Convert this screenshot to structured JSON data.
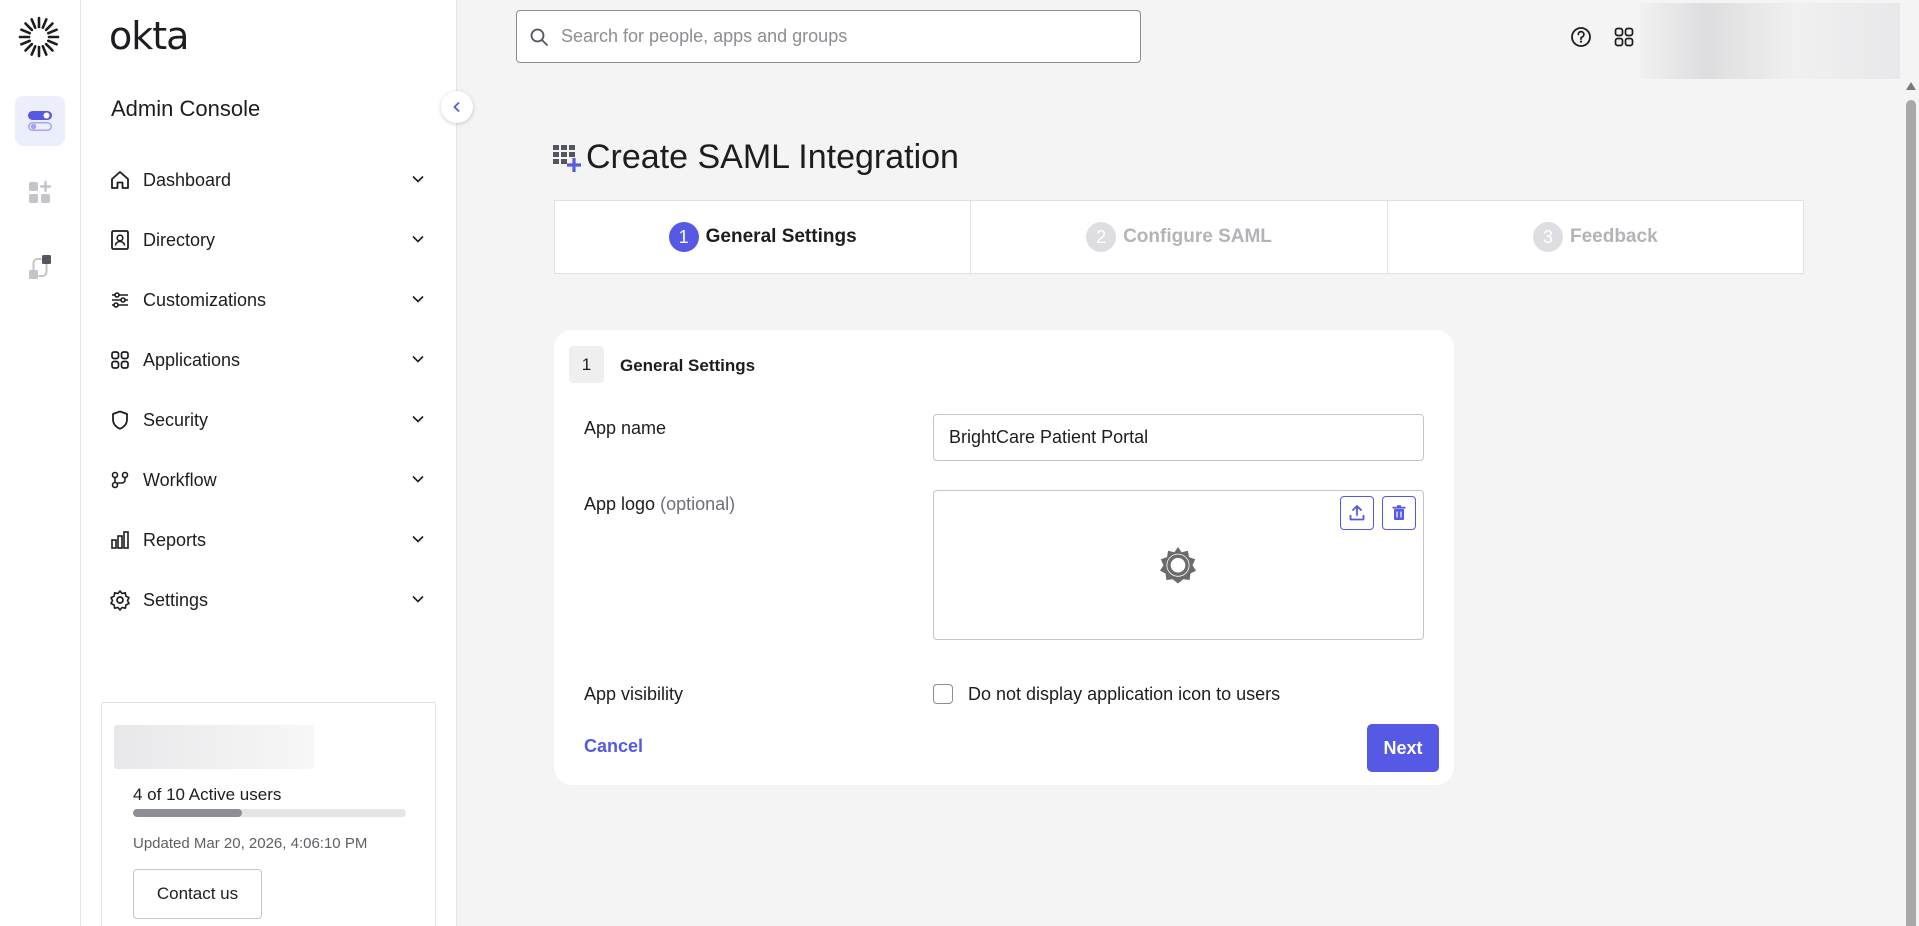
{
  "brand": {
    "wordmark": "okta",
    "accent": "#5559e3"
  },
  "rail": {
    "items": [
      "toggle-icon",
      "add-apps-icon",
      "integrations-icon"
    ]
  },
  "sidebar": {
    "console_title": "Admin Console",
    "items": [
      {
        "label": "Dashboard",
        "icon": "home-icon"
      },
      {
        "label": "Directory",
        "icon": "directory-icon"
      },
      {
        "label": "Customizations",
        "icon": "sliders-icon"
      },
      {
        "label": "Applications",
        "icon": "apps-grid-icon"
      },
      {
        "label": "Security",
        "icon": "shield-icon"
      },
      {
        "label": "Workflow",
        "icon": "workflow-icon"
      },
      {
        "label": "Reports",
        "icon": "bar-chart-icon"
      },
      {
        "label": "Settings",
        "icon": "gear-icon"
      }
    ],
    "usage": {
      "active_users_text": "4 of 10 Active users",
      "active_fraction": 0.4,
      "updated_text": "Updated Mar 20, 2026, 4:06:10 PM",
      "contact_label": "Contact us"
    }
  },
  "search": {
    "placeholder": "Search for people, apps and groups"
  },
  "page": {
    "title": "Create SAML Integration",
    "steps": [
      {
        "num": "1",
        "label": "General Settings",
        "state": "active"
      },
      {
        "num": "2",
        "label": "Configure SAML",
        "state": "inactive"
      },
      {
        "num": "3",
        "label": "Feedback",
        "state": "inactive"
      }
    ]
  },
  "form": {
    "section_num": "1",
    "section_title": "General Settings",
    "app_name_label": "App name",
    "app_name_value": "BrightCare Patient Portal",
    "app_logo_label": "App logo",
    "app_logo_optional": "(optional)",
    "visibility_label": "App visibility",
    "visibility_checkbox_label": "Do not display application icon to users",
    "visibility_checked": false,
    "cancel_label": "Cancel",
    "next_label": "Next"
  }
}
